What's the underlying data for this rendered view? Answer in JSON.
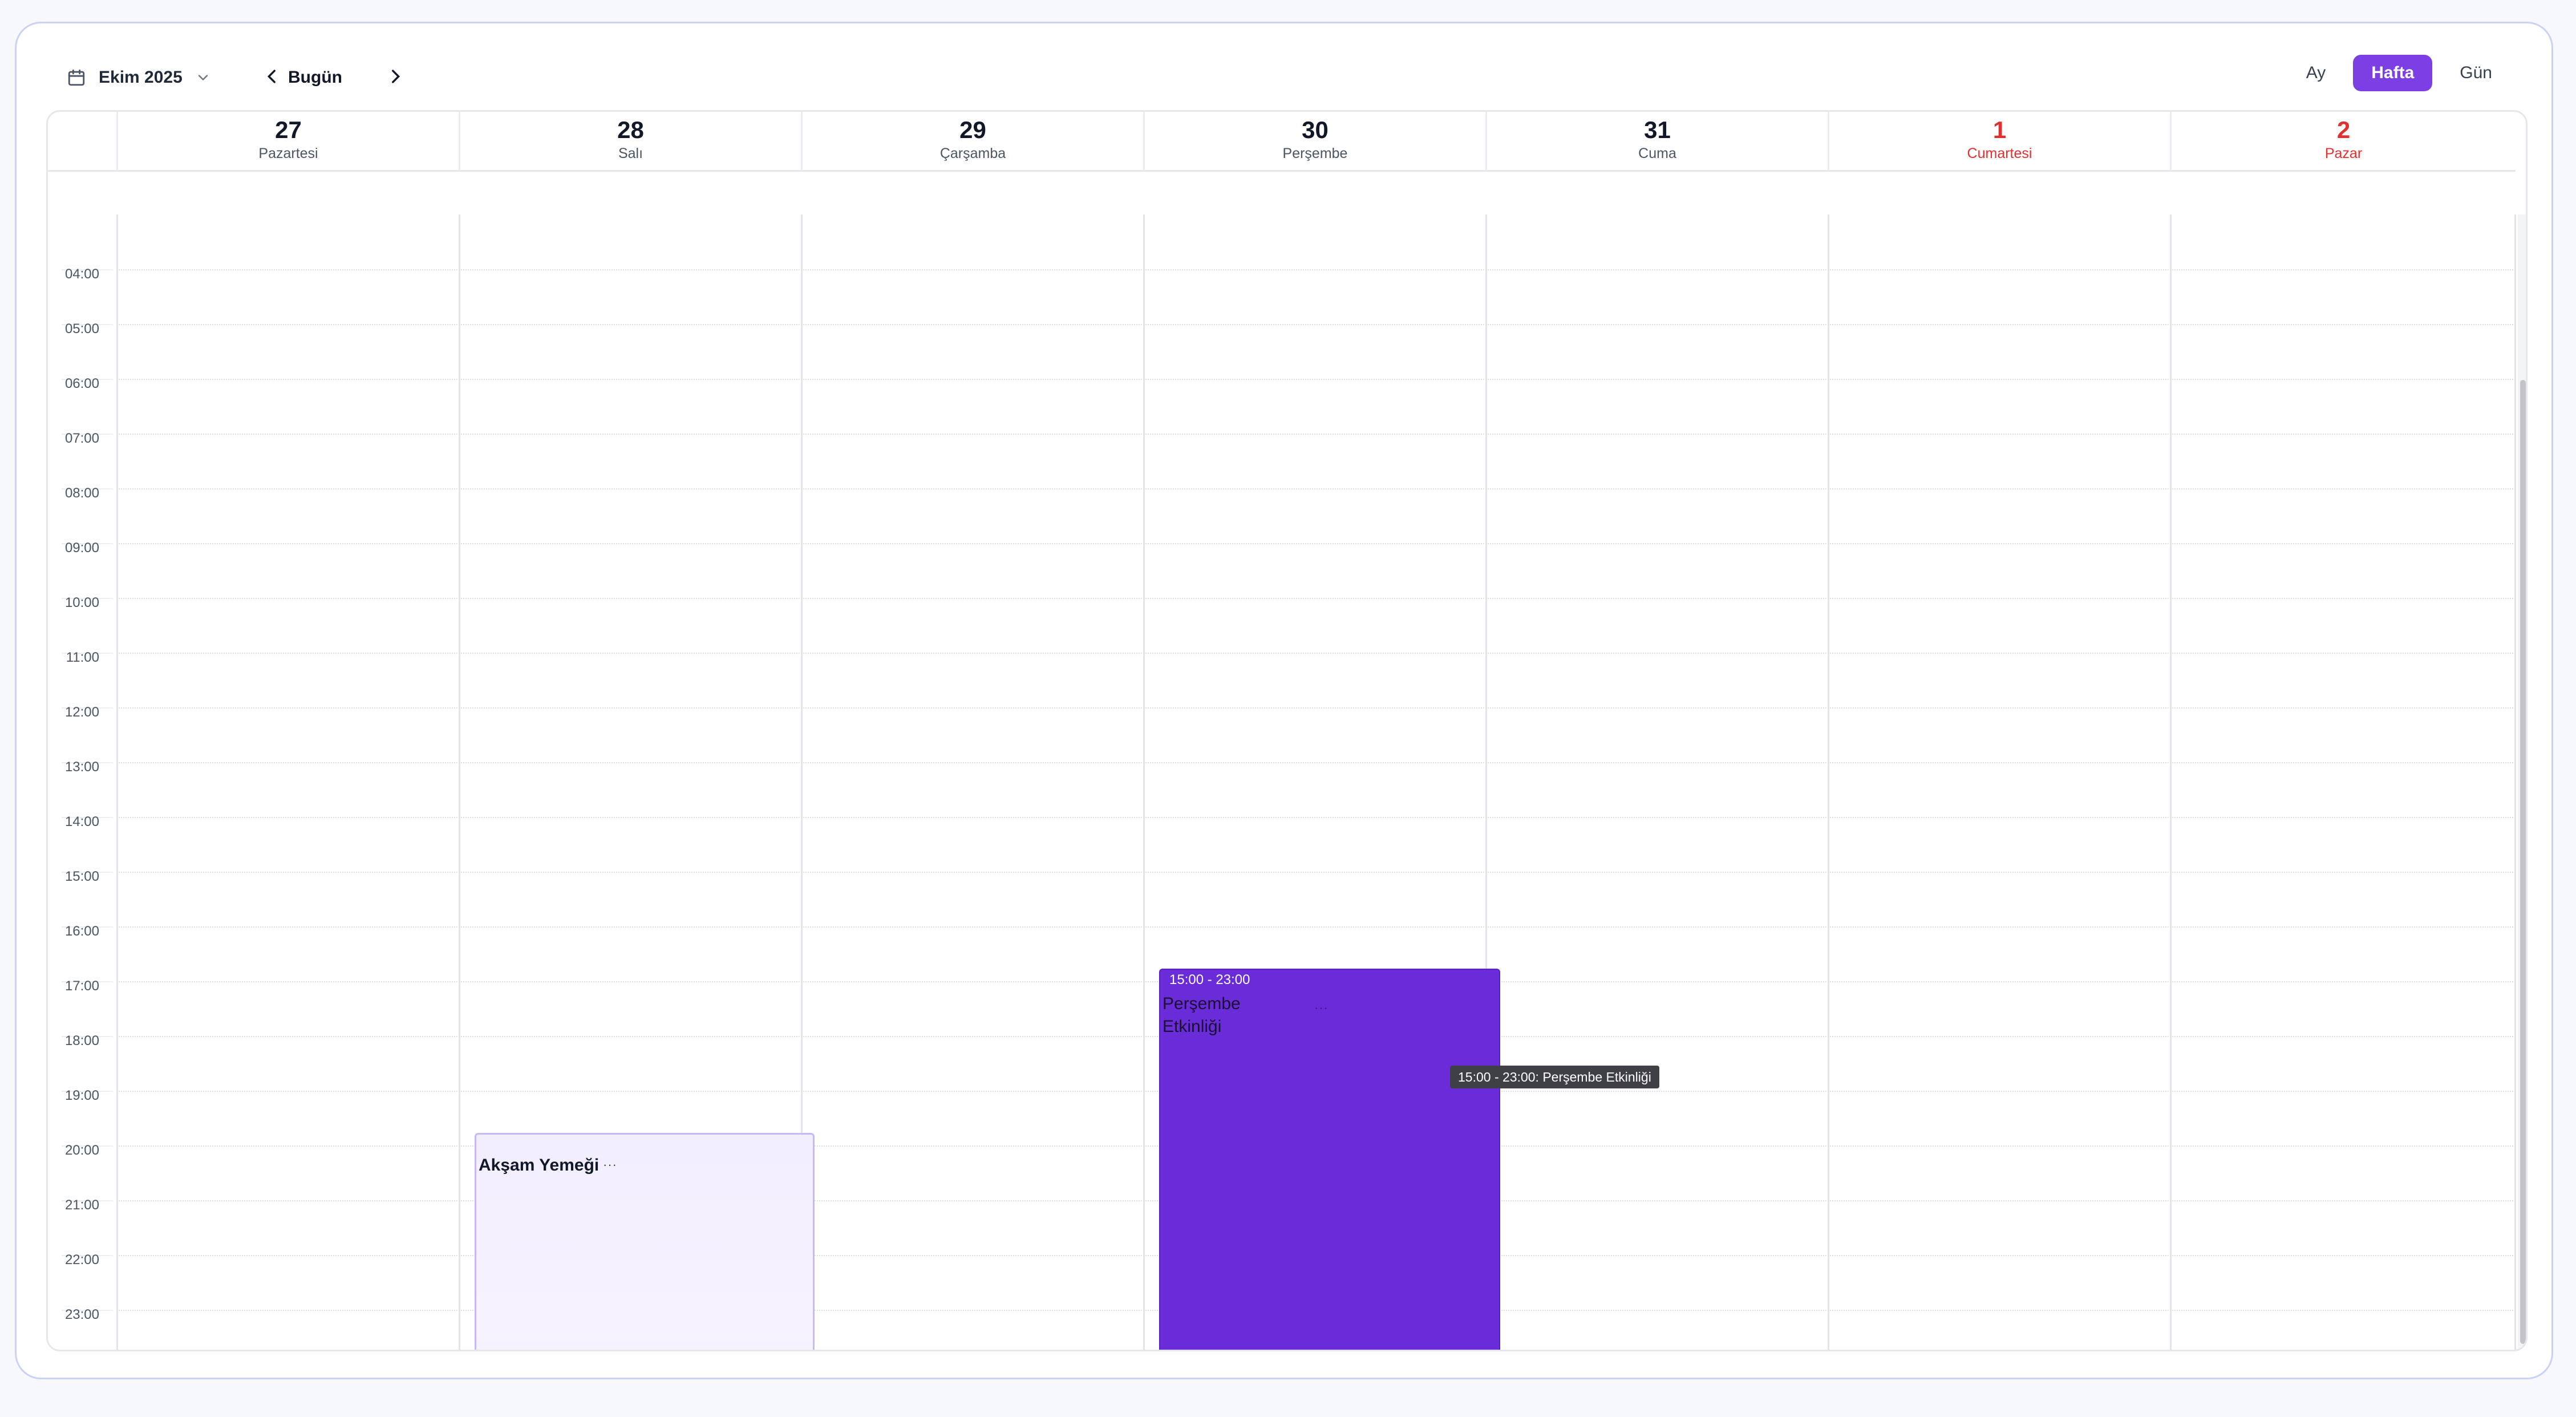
{
  "toolbar": {
    "month_label": "Ekim 2025",
    "today_label": "Bugün",
    "views": [
      {
        "label": "Ay",
        "active": false
      },
      {
        "label": "Hafta",
        "active": true
      },
      {
        "label": "Gün",
        "active": false
      }
    ]
  },
  "days": [
    {
      "num": "27",
      "name": "Pazartesi",
      "weekend": false
    },
    {
      "num": "28",
      "name": "Salı",
      "weekend": false
    },
    {
      "num": "29",
      "name": "Çarşamba",
      "weekend": false
    },
    {
      "num": "30",
      "name": "Perşembe",
      "weekend": false
    },
    {
      "num": "31",
      "name": "Cuma",
      "weekend": false
    },
    {
      "num": "1",
      "name": "Cumartesi",
      "weekend": true
    },
    {
      "num": "2",
      "name": "Pazar",
      "weekend": true
    }
  ],
  "hours": [
    "04:00",
    "05:00",
    "06:00",
    "07:00",
    "08:00",
    "09:00",
    "10:00",
    "11:00",
    "12:00",
    "13:00",
    "14:00",
    "15:00",
    "16:00",
    "17:00",
    "18:00",
    "19:00",
    "20:00",
    "21:00",
    "22:00",
    "23:00"
  ],
  "events": {
    "dinner": {
      "title": "Akşam Yemeği",
      "more": "···"
    },
    "thursday": {
      "time": "15:00 - 23:00",
      "title": "Perşembe Etkinliği",
      "more": "···"
    }
  },
  "tooltip": "15:00 - 23:00: Perşembe Etkinliği",
  "colors": {
    "accent": "#7b3fe4",
    "event_fill": "#6a2bd9",
    "weekend": "#e03131"
  }
}
